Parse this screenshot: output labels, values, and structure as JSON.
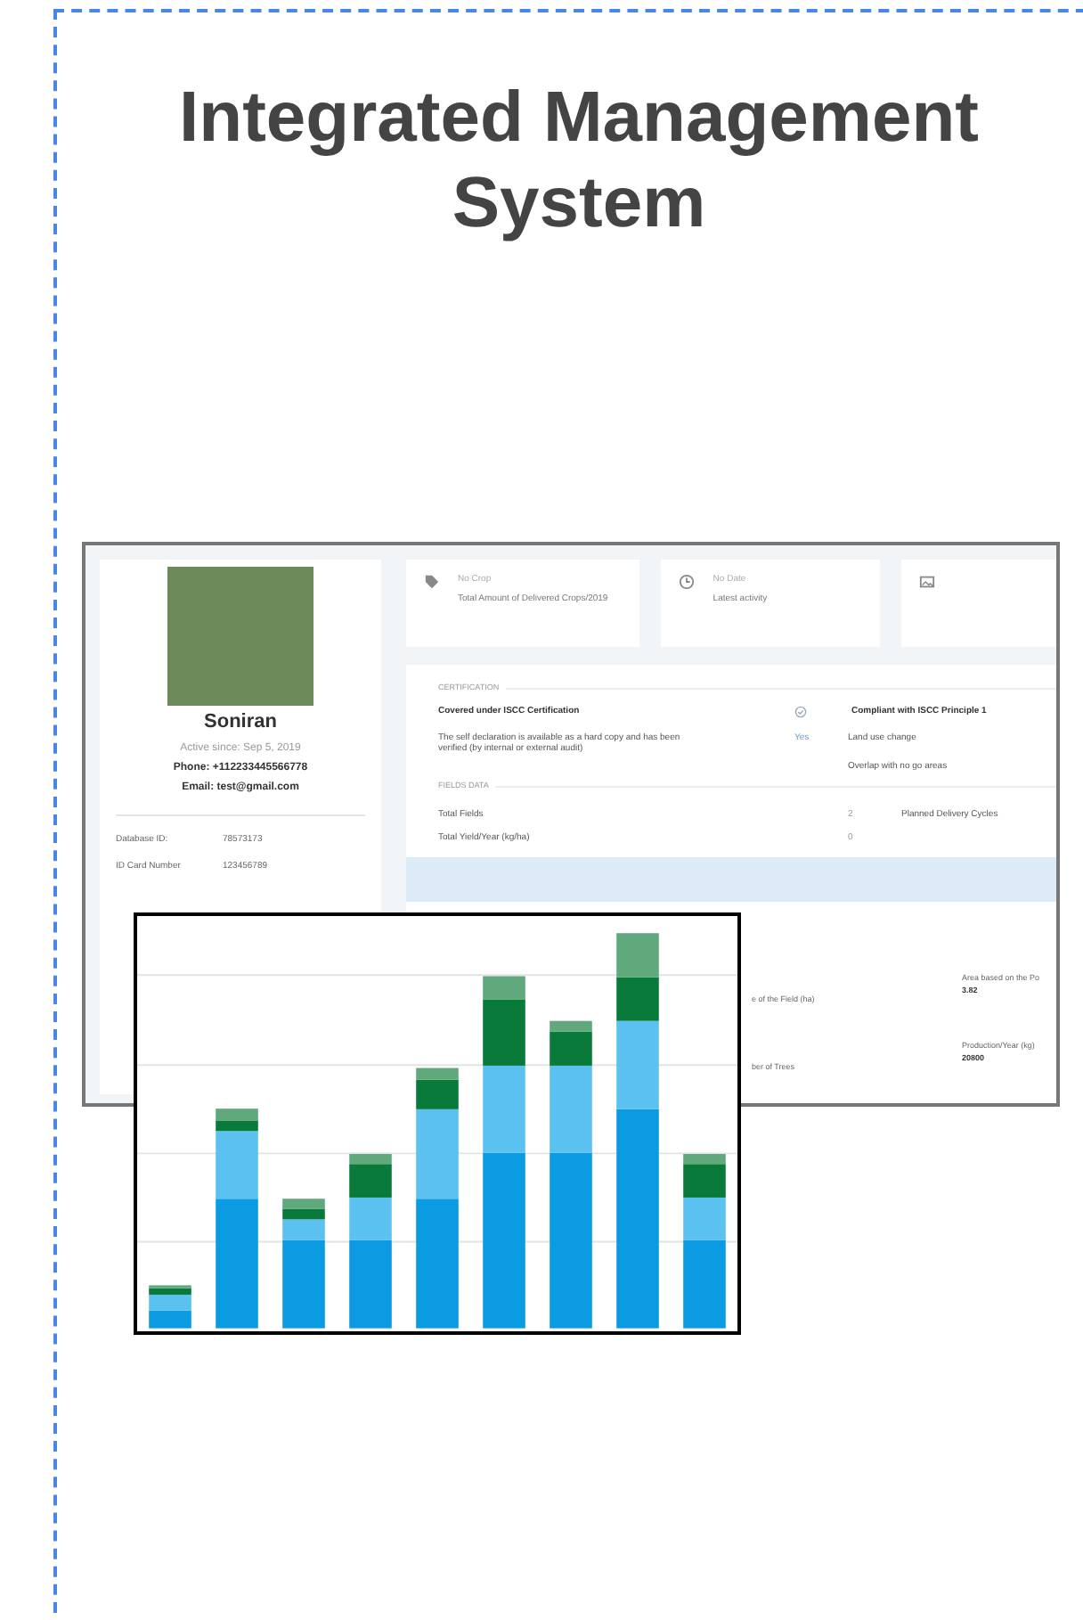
{
  "title": "Integrated Management System",
  "screenshot": {
    "profile": {
      "name": "Soniran",
      "active_since": "Active since: Sep 5, 2019",
      "phone": "Phone: +112233445566778",
      "email": "Email: test@gmail.com",
      "details": [
        {
          "label": "Database ID:",
          "value": "78573173"
        },
        {
          "label": "ID Card Number",
          "value": "123456789"
        }
      ]
    },
    "stat_cards": [
      {
        "value": "No Crop",
        "label": "Total Amount of Delivered Crops/2019"
      },
      {
        "value": "No Date",
        "label": "Latest activity"
      }
    ],
    "certification": {
      "heading": "CERTIFICATION",
      "covered": "Covered under ISCC Certification",
      "compliant": "Compliant with ISCC Principle 1",
      "declaration": "The self declaration is available as a hard copy and has been verified (by internal or external audit)",
      "answer": "Yes",
      "land_use": "Land use change",
      "overlap": "Overlap with no go areas"
    },
    "fields_data": {
      "heading": "FIELDS DATA",
      "rows": [
        {
          "label": "Total Fields",
          "value": "2",
          "extra": "Planned Delivery Cycles"
        },
        {
          "label": "Total Yield/Year (kg/ha)",
          "value": "0"
        }
      ]
    },
    "field_details": [
      {
        "label": "e of the Field (ha)",
        "other_label": "Area based on the Po",
        "other_value": "3.82"
      },
      {
        "label": "ber of Trees",
        "other_label": "Production/Year (kg)",
        "other_value": "20800"
      }
    ]
  }
}
